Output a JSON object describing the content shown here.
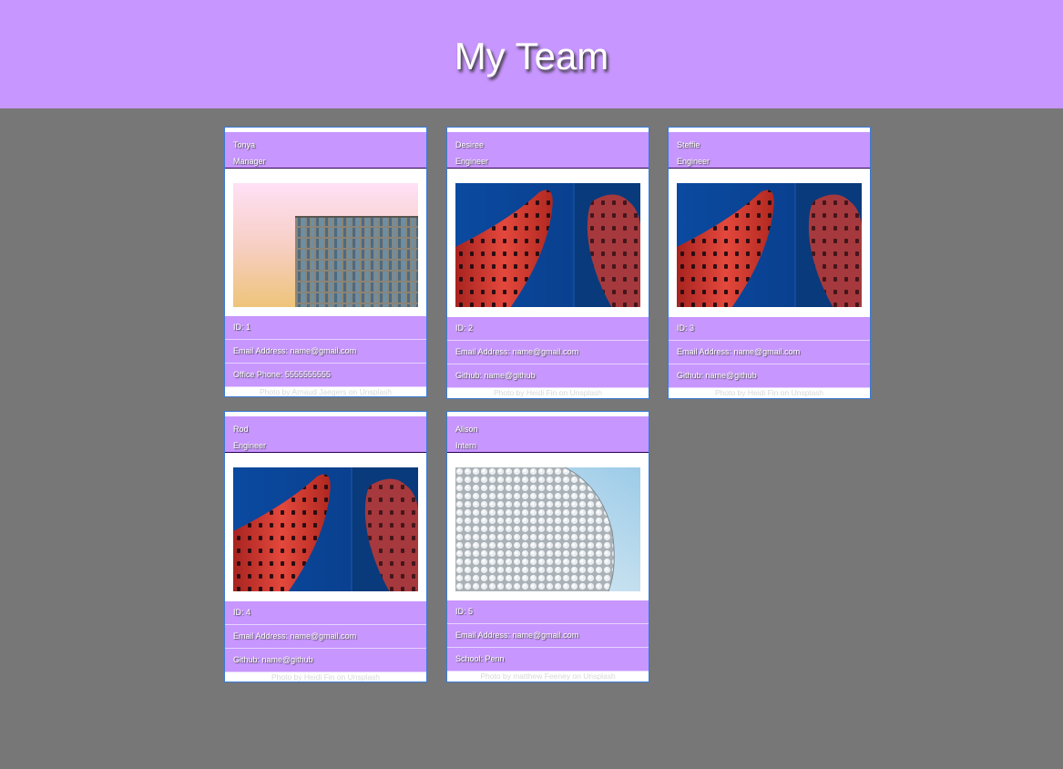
{
  "page": {
    "title": "My Team"
  },
  "colors": {
    "header_bg": "#c896ff",
    "page_bg": "#777777",
    "card_border": "#3b7bd6"
  },
  "team": [
    {
      "name": "Tonya",
      "role": "Manager",
      "image": "building-gradient-photo",
      "id_text": "ID: 1",
      "email_text": "Email Address: name@gmail.com",
      "extra_text": "Office Phone: 5555555555",
      "credit": "Photo by Arnaud Jaegers on Unsplash"
    },
    {
      "name": "Desiree",
      "role": "Engineer",
      "image": "red-tower-photo",
      "id_text": "ID: 2",
      "email_text": "Email Address: name@gmail.com",
      "extra_text": "Github: name@github",
      "credit": "Photo by Heidi Fin on Unsplash"
    },
    {
      "name": "Steffie",
      "role": "Engineer",
      "image": "red-tower-photo",
      "id_text": "ID: 3",
      "email_text": "Email Address: name@gmail.com",
      "extra_text": "Github: name@github",
      "credit": "Photo by Heidi Fin on Unsplash"
    },
    {
      "name": "Rod",
      "role": "Engineer",
      "image": "red-tower-photo",
      "id_text": "ID: 4",
      "email_text": "Email Address: name@gmail.com",
      "extra_text": "Github: name@github",
      "credit": "Photo by Heidi Fin on Unsplash"
    },
    {
      "name": "Alison",
      "role": "Intern",
      "image": "dotted-dome-photo",
      "id_text": "ID: 5",
      "email_text": "Email Address: name@gmail.com",
      "extra_text": "School: Penn",
      "credit": "Photo by matthew Feeney on Unsplash"
    }
  ]
}
